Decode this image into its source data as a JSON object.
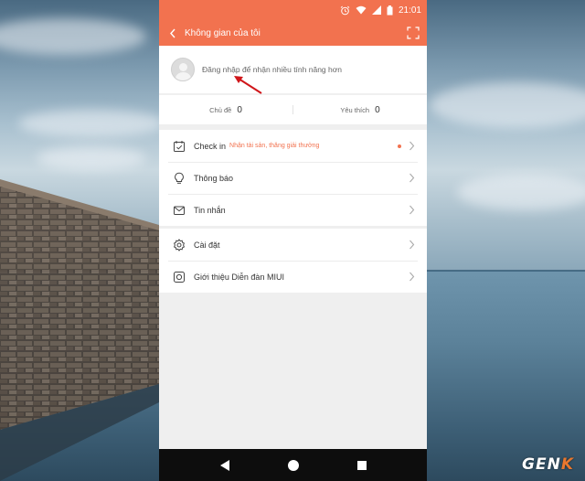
{
  "status_bar": {
    "time": "21:01"
  },
  "toolbar": {
    "title": "Không gian của tôi"
  },
  "profile": {
    "login_prompt": "Đăng nhập để nhận nhiều tính năng hơn"
  },
  "stats": [
    {
      "label": "Chủ đề",
      "value": "0"
    },
    {
      "label": "Yêu thích",
      "value": "0"
    }
  ],
  "menu_group_1": [
    {
      "label": "Check in",
      "sub": "Nhận tài sản, thăng giải thưởng",
      "icon": "calendar-check-icon"
    },
    {
      "label": "Thông báo",
      "icon": "lightbulb-icon"
    },
    {
      "label": "Tin nhắn",
      "icon": "envelope-icon"
    }
  ],
  "menu_group_2": [
    {
      "label": "Cài đặt",
      "icon": "gear-icon"
    },
    {
      "label": "Giới thiệu Diễn đàn MIUI",
      "icon": "info-square-icon"
    }
  ],
  "watermark": {
    "main": "GEN",
    "accent": "K"
  },
  "colors": {
    "accent": "#f2724f",
    "nav_bar": "#0d0d0d",
    "annotation_arrow": "#d0161a"
  }
}
